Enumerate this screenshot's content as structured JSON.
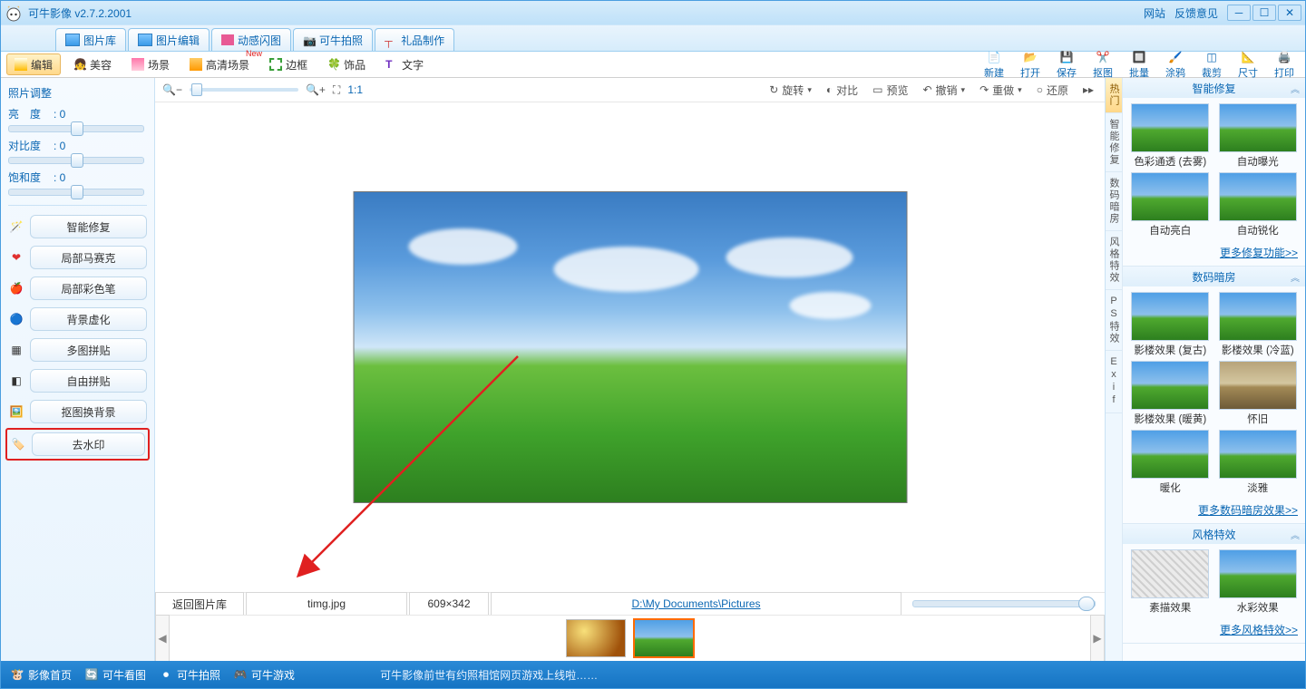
{
  "title": "可牛影像  v2.7.2.2001",
  "titlelinks": {
    "site": "网站",
    "feedback": "反馈意见"
  },
  "maintabs": [
    {
      "label": "图片库",
      "name": "tab-gallery"
    },
    {
      "label": "图片编辑",
      "name": "tab-edit"
    },
    {
      "label": "动感闪图",
      "name": "tab-gif"
    },
    {
      "label": "可牛拍照",
      "name": "tab-camera"
    },
    {
      "label": "礼品制作",
      "name": "tab-gift"
    }
  ],
  "subtabs": [
    {
      "label": "编辑",
      "name": "subtab-edit",
      "active": true
    },
    {
      "label": "美容",
      "name": "subtab-beauty"
    },
    {
      "label": "场景",
      "name": "subtab-scene"
    },
    {
      "label": "高清场景",
      "name": "subtab-hdscene",
      "new": true
    },
    {
      "label": "边框",
      "name": "subtab-frame"
    },
    {
      "label": "饰品",
      "name": "subtab-decor"
    },
    {
      "label": "文字",
      "name": "subtab-text"
    }
  ],
  "rightbuttons": [
    {
      "label": "新建",
      "name": "btn-new"
    },
    {
      "label": "打开",
      "name": "btn-open"
    },
    {
      "label": "保存",
      "name": "btn-save"
    },
    {
      "label": "抠图",
      "name": "btn-cutout"
    },
    {
      "label": "批量",
      "name": "btn-batch"
    },
    {
      "label": "涂鸦",
      "name": "btn-doodle"
    },
    {
      "label": "裁剪",
      "name": "btn-crop"
    },
    {
      "label": "尺寸",
      "name": "btn-size"
    },
    {
      "label": "打印",
      "name": "btn-print"
    }
  ],
  "leftpanel": {
    "title": "照片调整",
    "sliders": [
      {
        "label": "亮　度",
        "value": ": 0",
        "name": "slider-brightness"
      },
      {
        "label": "对比度",
        "value": ": 0",
        "name": "slider-contrast"
      },
      {
        "label": "饱和度",
        "value": ": 0",
        "name": "slider-saturation"
      }
    ],
    "buttons": [
      {
        "label": "智能修复",
        "name": "lp-smart-repair"
      },
      {
        "label": "局部马赛克",
        "name": "lp-mosaic"
      },
      {
        "label": "局部彩色笔",
        "name": "lp-colorpen"
      },
      {
        "label": "背景虚化",
        "name": "lp-blur-bg"
      },
      {
        "label": "多图拼贴",
        "name": "lp-multi-collage"
      },
      {
        "label": "自由拼贴",
        "name": "lp-free-collage"
      },
      {
        "label": "抠图换背景",
        "name": "lp-cutout-bg"
      },
      {
        "label": "去水印",
        "name": "lp-remove-watermark",
        "highlight": true
      }
    ]
  },
  "canvasctrl": {
    "onetoone": "1:1",
    "rotate": "旋转",
    "compare": "对比",
    "preview": "预览",
    "undo": "撤销",
    "redo": "重做",
    "restore": "还原"
  },
  "status": {
    "back": "返回图片库",
    "filename": "timg.jpg",
    "dims": "609×342",
    "path": "D:\\My Documents\\Pictures"
  },
  "vtabs": [
    {
      "label": "热门",
      "name": "vtab-hot",
      "active": true
    },
    {
      "label": "智能修复",
      "name": "vtab-smart"
    },
    {
      "label": "数码暗房",
      "name": "vtab-darkroom"
    },
    {
      "label": "风格特效",
      "name": "vtab-style"
    },
    {
      "label": "PS特效",
      "name": "vtab-ps"
    },
    {
      "label": "Exif",
      "name": "vtab-exif"
    }
  ],
  "effects": {
    "sec1": {
      "title": "智能修复",
      "items": [
        "色彩通透 (去雾)",
        "自动曝光",
        "自动亮白",
        "自动锐化"
      ],
      "more": "更多修复功能>>"
    },
    "sec2": {
      "title": "数码暗房",
      "items": [
        "影楼效果 (复古)",
        "影楼效果 (冷蓝)",
        "影楼效果 (暖黄)",
        "怀旧",
        "暖化",
        "淡雅"
      ],
      "more": "更多数码暗房效果>>"
    },
    "sec3": {
      "title": "风格特效",
      "items": [
        "素描效果",
        "水彩效果"
      ],
      "more": "更多风格特效>>"
    }
  },
  "bottombar": {
    "items": [
      {
        "label": "影像首页",
        "name": "bb-home"
      },
      {
        "label": "可牛看图",
        "name": "bb-view"
      },
      {
        "label": "可牛拍照",
        "name": "bb-camera"
      },
      {
        "label": "可牛游戏",
        "name": "bb-game"
      }
    ],
    "msg": "可牛影像前世有约照相馆网页游戏上线啦……"
  }
}
